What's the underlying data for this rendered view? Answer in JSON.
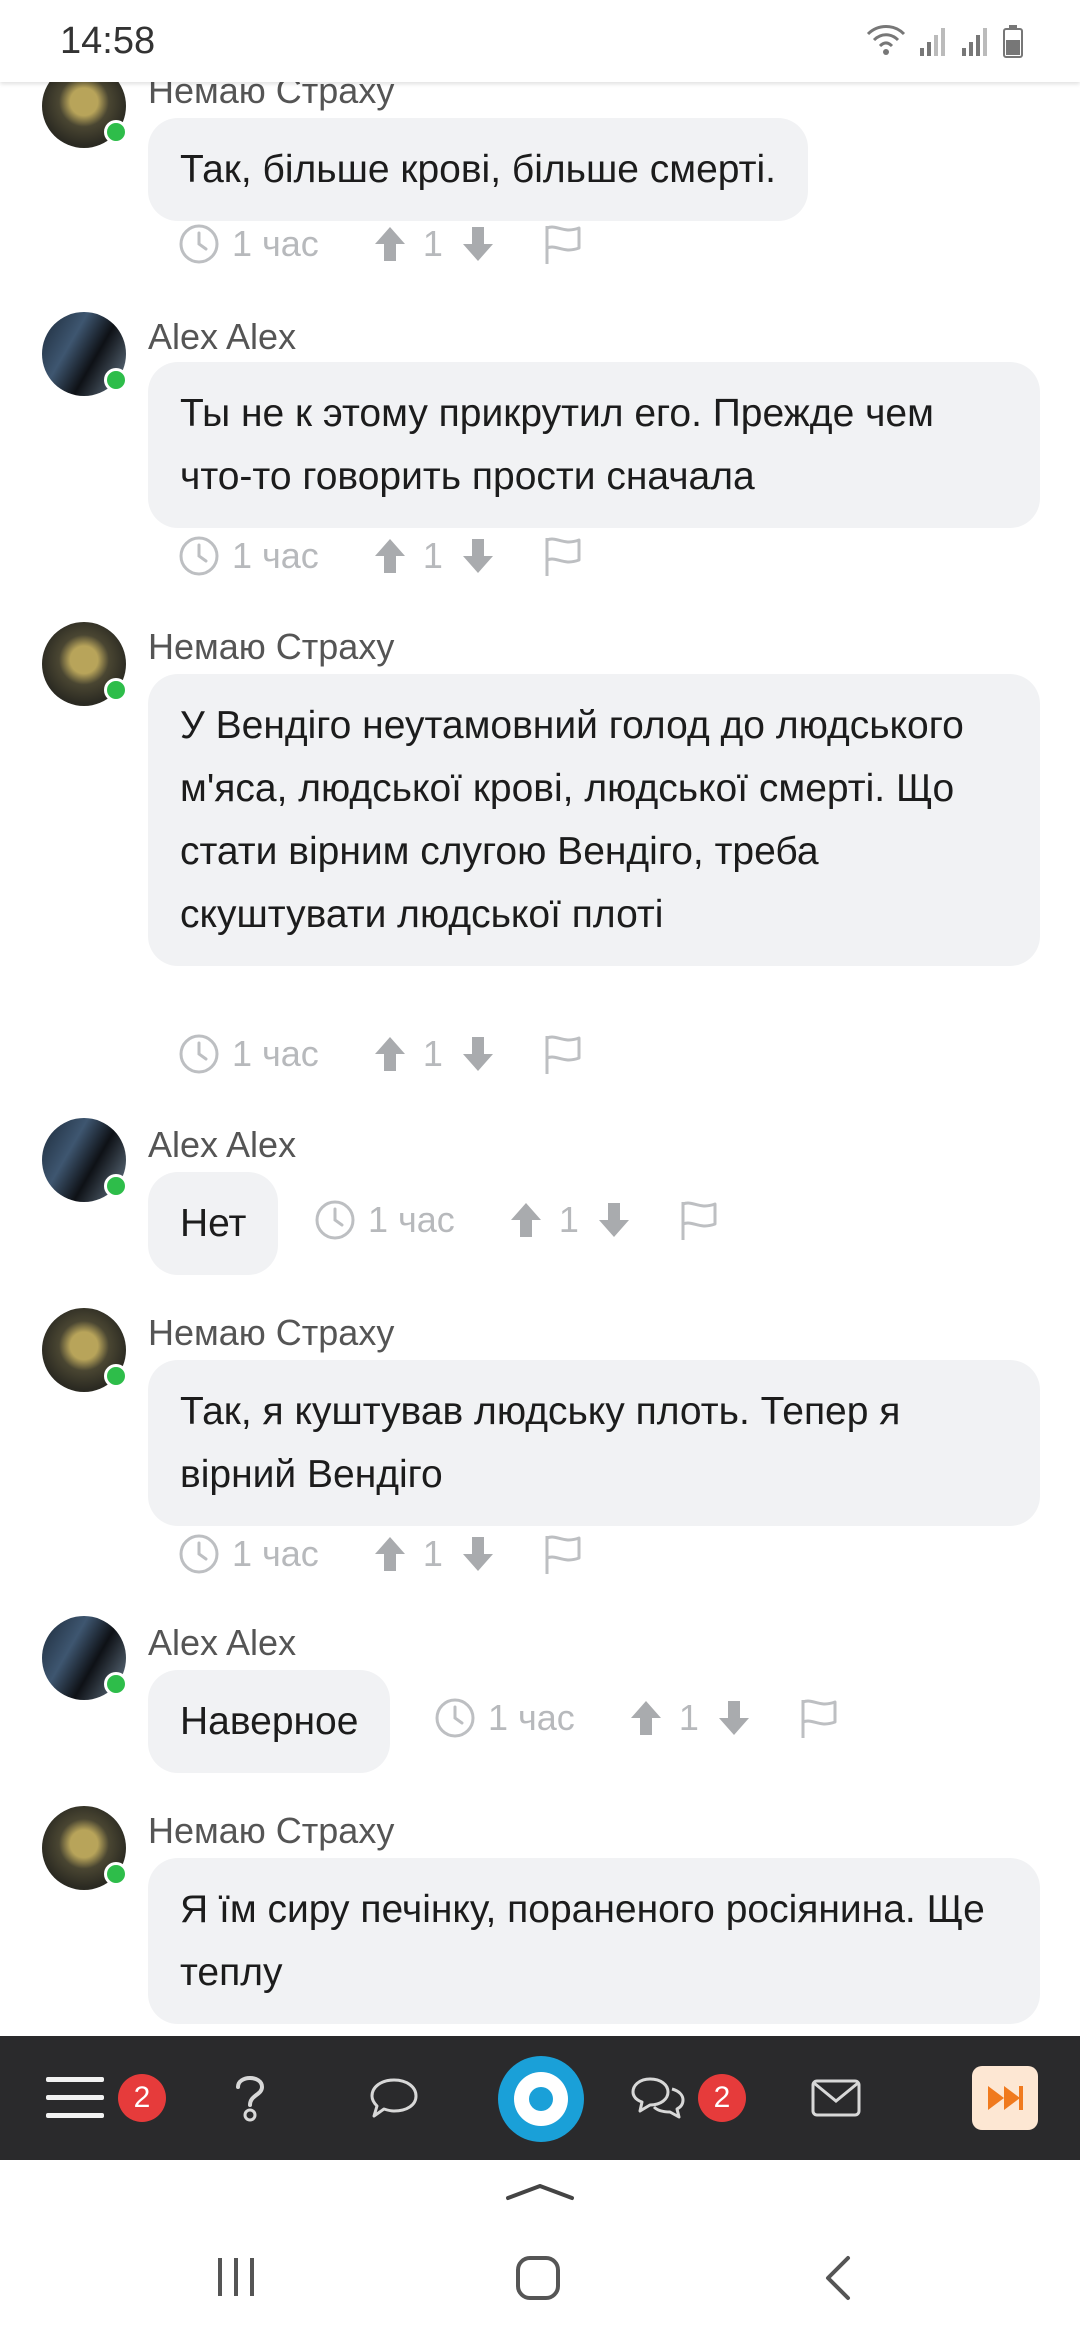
{
  "status_bar": {
    "time": "14:58"
  },
  "comments": [
    {
      "author": "Немаю Страху",
      "avatar": "gold",
      "text": "Так, більше крові, більше смерті.",
      "time": "1 час",
      "votes": "1"
    },
    {
      "author": "Alex Alex",
      "avatar": "alex",
      "text": "Ты не к этому прикрутил его. Прежде чем что-то говорить прости сначала",
      "time": "1 час",
      "votes": "1"
    },
    {
      "author": "Немаю Страху",
      "avatar": "gold",
      "text": "У Вендіго неутамовний голод до людського м'яса, людської крові, людської смерті. Що стати вірним слугою Вендіго, треба скуштувати людської плоті",
      "time": "1 час",
      "votes": "1"
    },
    {
      "author": "Alex Alex",
      "avatar": "alex",
      "text": "Нет",
      "time": "1 час",
      "votes": "1"
    },
    {
      "author": "Немаю Страху",
      "avatar": "gold",
      "text": "Так, я куштував людську плоть. Тепер я вірний Вендіго",
      "time": "1 час",
      "votes": "1"
    },
    {
      "author": "Alex Alex",
      "avatar": "alex",
      "text": "Наверное",
      "time": "1 час",
      "votes": "1"
    },
    {
      "author": "Немаю Страху",
      "avatar": "gold",
      "text": "Я їм сиру печінку, пораненого росіянина. Ще теплу",
      "time": "",
      "votes": ""
    }
  ],
  "toolbar": {
    "menu_badge": "2",
    "messages_badge": "2",
    "icons": [
      "menu-icon",
      "question-icon",
      "comment-icon",
      "logo-icon",
      "chat-icon",
      "mail-icon",
      "fast-forward-icon"
    ],
    "accent_color": "#1aa0d8",
    "badge_color": "#e63b3b"
  },
  "system_nav": {
    "icons": [
      "recent-apps-icon",
      "home-icon",
      "back-icon"
    ]
  }
}
